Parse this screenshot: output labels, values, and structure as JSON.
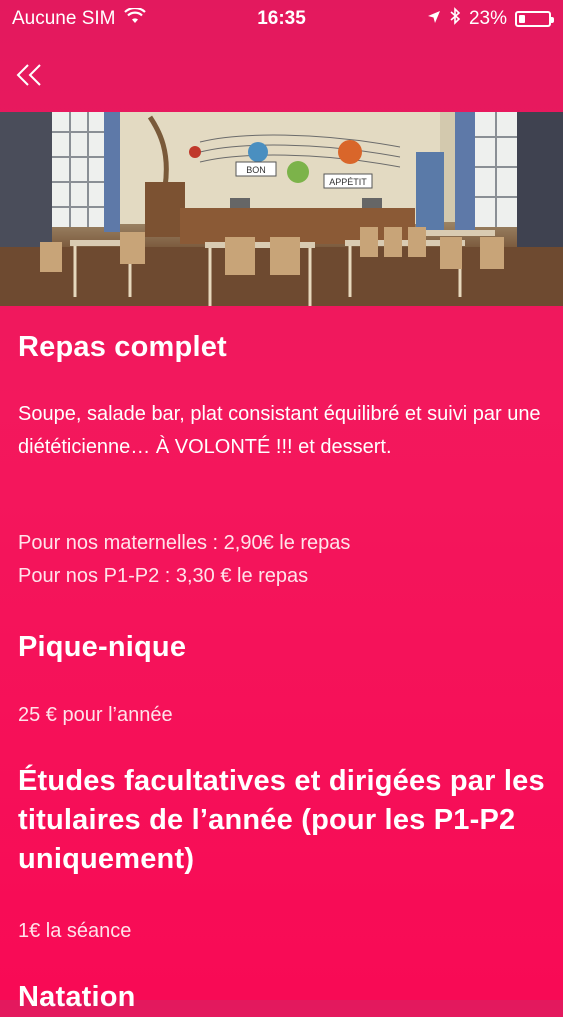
{
  "status_bar": {
    "carrier": "Aucune SIM",
    "time": "16:35",
    "battery_percent": "23%",
    "battery_level": 0.23,
    "icons": [
      "wifi-icon",
      "location-arrow-icon",
      "bluetooth-icon",
      "battery-icon"
    ]
  },
  "nav": {
    "back_icon": "double-chevron-left-icon"
  },
  "hero": {
    "sign_left": "BON",
    "sign_right": "APPÉTIT"
  },
  "sections": [
    {
      "title": "Repas complet",
      "text": "Soupe, salade bar, plat consistant équilibré et suivi par une diététicienne… À VOLONTÉ !!! et dessert.",
      "price_line_1": "Pour nos maternelles : 2,90€ le repas",
      "price_line_2": "Pour nos P1-P2 : 3,30 € le repas"
    },
    {
      "title": "Pique-nique",
      "text": "25 € pour l’année"
    },
    {
      "title": "Études facultatives et dirigées par les titulaires de l’année (pour les P1-P2 uniquement)",
      "text": "1€ la séance"
    },
    {
      "title": "Natation"
    }
  ],
  "colors": {
    "background": "#f3185d",
    "text": "#ffffff"
  }
}
